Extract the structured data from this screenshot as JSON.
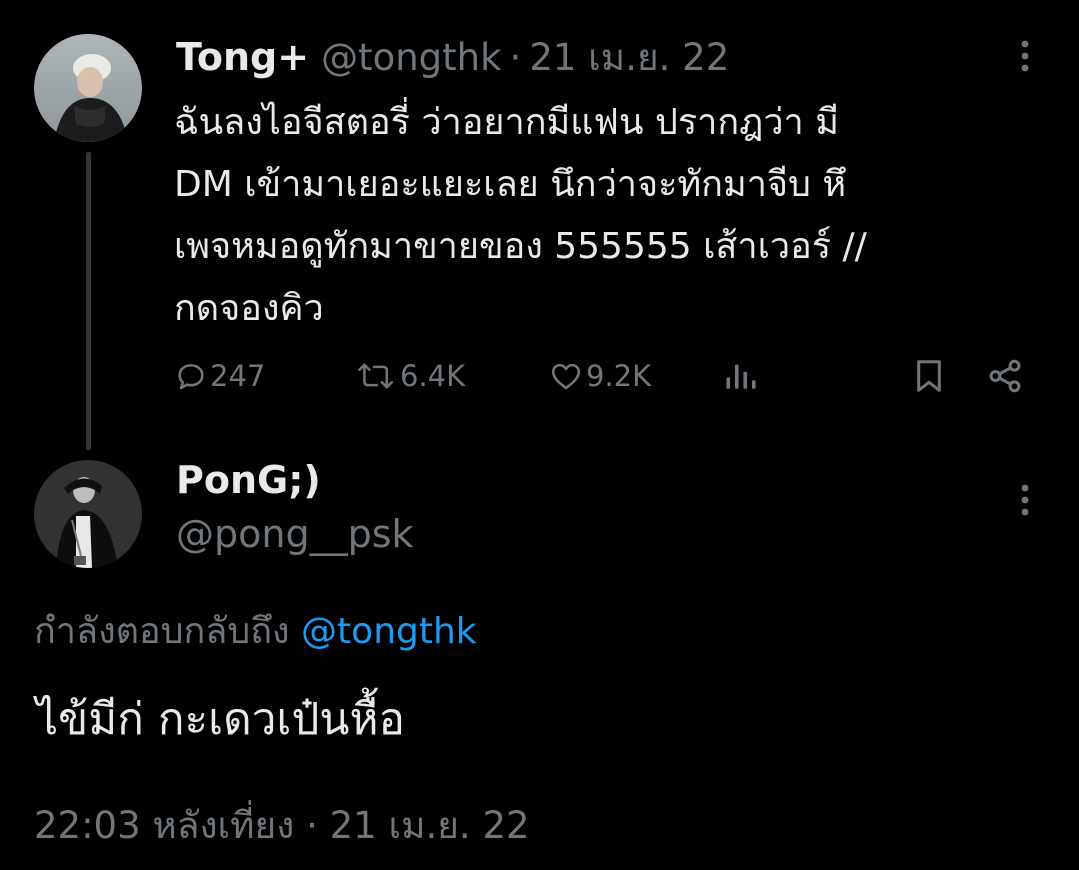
{
  "colors": {
    "background": "#000000",
    "text_primary": "#e7e9ea",
    "text_secondary": "#71767b",
    "accent": "#1d9bf0",
    "thread_line": "#333639"
  },
  "original_tweet": {
    "avatar_icon": "user-avatar-image",
    "display_name": "Tong+",
    "handle": "@tongthk",
    "separator": "·",
    "date": "21 เม.ย. 22",
    "body_lines": [
      "ฉันลงไอจีสตอรี่ ว่าอยากมีแฟน ปรากฎว่า มี",
      "DM เข้ามาเยอะแยะเลย นึกว่าจะทักมาจีบ หึ",
      "เพจหมอดูทักมาขายของ 555555 เส้าเวอร์ //",
      "กดจองคิว"
    ],
    "actions": {
      "reply_icon": "reply-icon",
      "reply_count": "247",
      "retweet_icon": "retweet-icon",
      "retweet_count": "6.4K",
      "like_icon": "heart-icon",
      "like_count": "9.2K",
      "views_icon": "views-icon",
      "bookmark_icon": "bookmark-icon",
      "share_icon": "share-icon"
    },
    "more_icon": "more-vertical-icon"
  },
  "reply_tweet": {
    "avatar_icon": "user-avatar-image",
    "display_name": "PonG;)",
    "handle": "@pong__psk",
    "replying_to_label": "กำลังตอบกลับถึง",
    "replying_to_handle": "@tongthk",
    "text": "ไข้มีก่ กะเดวเป๋นหื้อ",
    "time": "22:03 หลังเที่ยง",
    "separator": "·",
    "date": "21 เม.ย. 22",
    "more_icon": "more-vertical-icon"
  }
}
